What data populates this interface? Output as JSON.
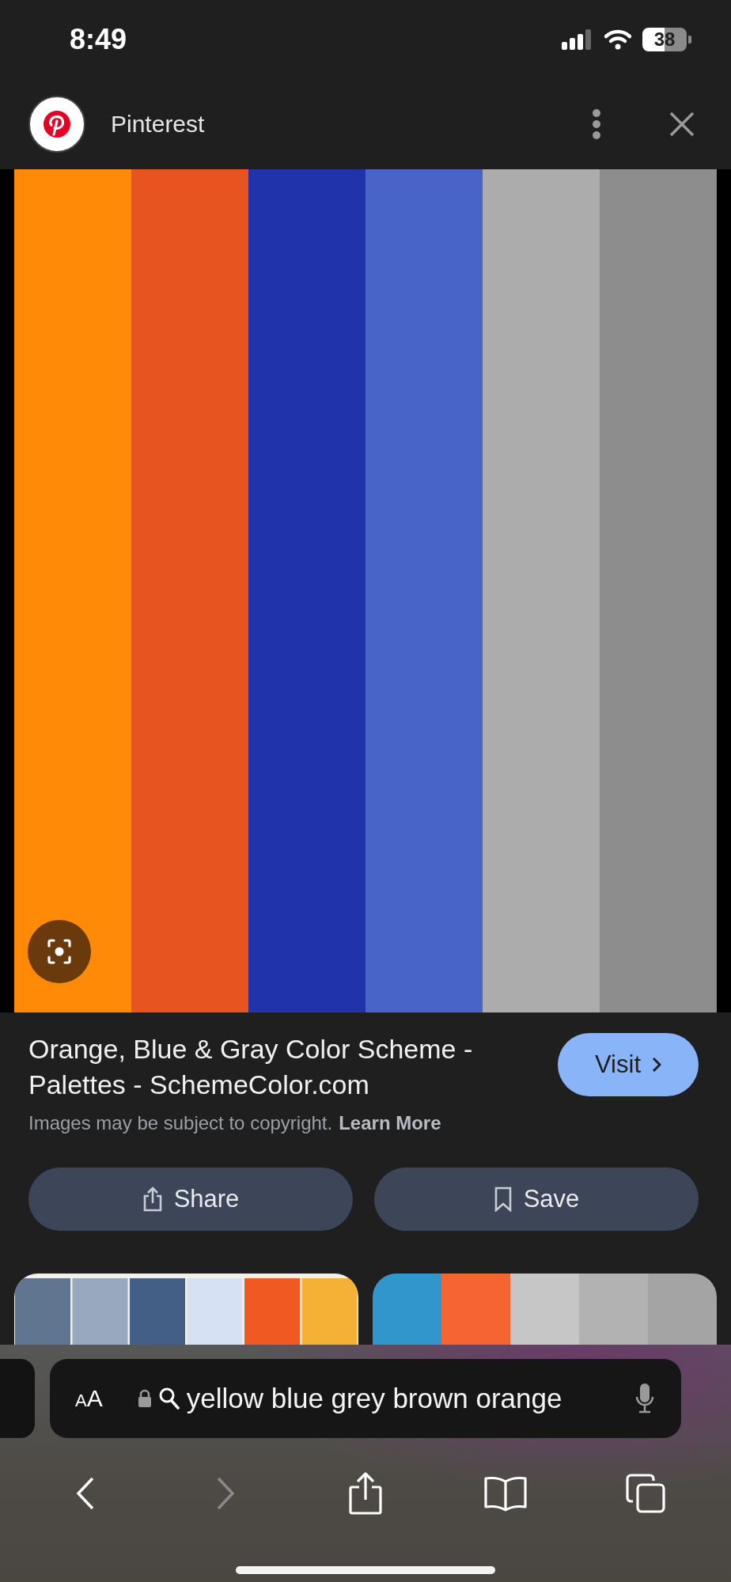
{
  "status_bar": {
    "time": "8:49",
    "battery": "38"
  },
  "header": {
    "title": "Pinterest"
  },
  "result": {
    "title": "Orange, Blue & Gray Color Scheme - Palettes - SchemeColor.com",
    "visit_button": "Visit",
    "notice": "Images may be subject to copyright.",
    "notice_link": "Learn More",
    "actions": [
      {
        "kind": "share",
        "label": "Share"
      },
      {
        "kind": "save",
        "label": "Save"
      }
    ]
  },
  "address_bar": {
    "text_size_button": "AA",
    "query": "yellow blue grey brown orange"
  },
  "toolbar": [
    {
      "kind": "back",
      "disabled": false
    },
    {
      "kind": "forward",
      "disabled": true
    },
    {
      "kind": "share",
      "disabled": false
    },
    {
      "kind": "bookmarks",
      "disabled": false
    },
    {
      "kind": "tabs",
      "disabled": false
    }
  ]
}
